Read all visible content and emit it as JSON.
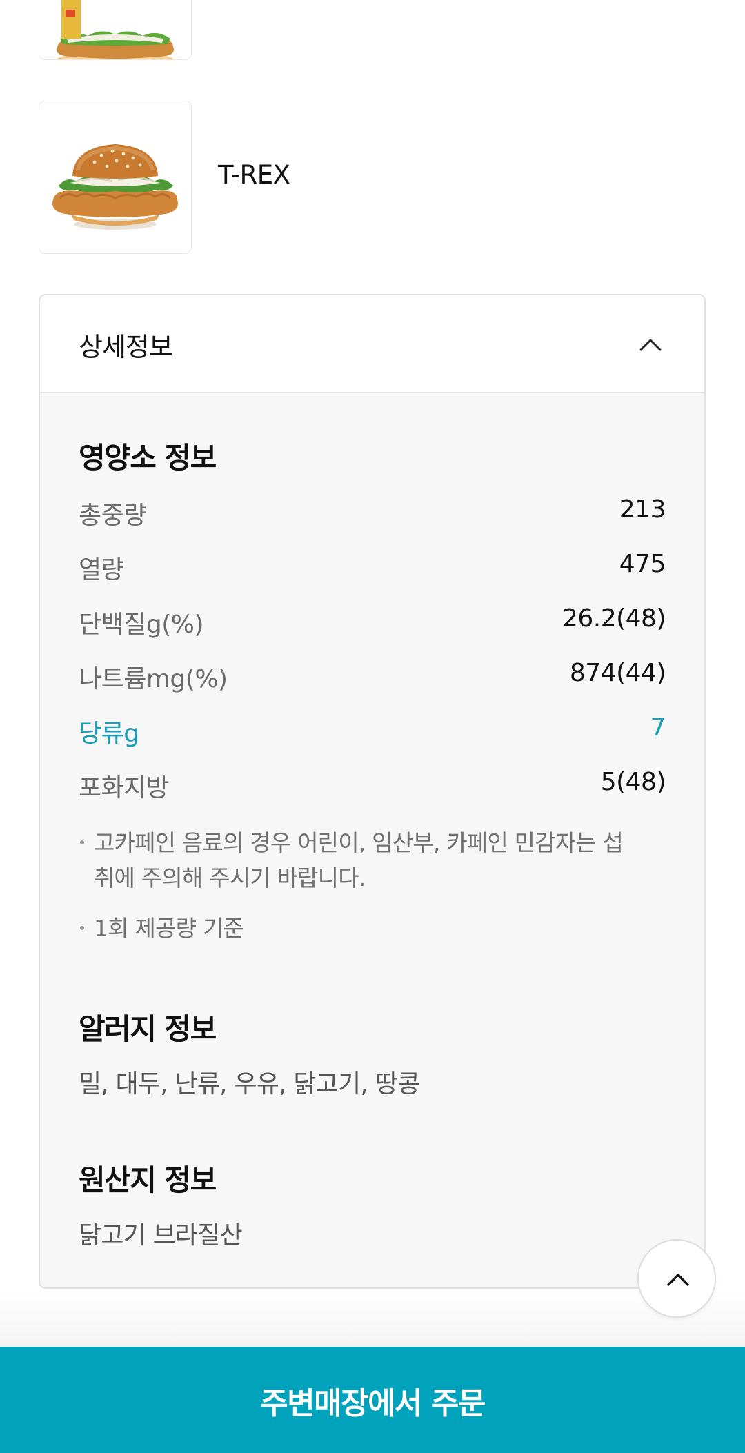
{
  "product": {
    "name": "T-REX"
  },
  "detail": {
    "title": "상세정보",
    "nutrition": {
      "title": "영양소 정보",
      "rows": [
        {
          "label": "총중량",
          "value": "213",
          "highlight": false
        },
        {
          "label": "열량",
          "value": "475",
          "highlight": false
        },
        {
          "label": "단백질g(%)",
          "value": "26.2(48)",
          "highlight": false
        },
        {
          "label": "나트륨mg(%)",
          "value": "874(44)",
          "highlight": false
        },
        {
          "label": "당류g",
          "value": "7",
          "highlight": true
        },
        {
          "label": "포화지방",
          "value": "5(48)",
          "highlight": false
        }
      ],
      "notes": [
        "고카페인 음료의 경우 어린이, 임산부, 카페인 민감자는 섭취에 주의해 주시기 바랍니다.",
        "1회 제공량 기준"
      ]
    },
    "allergy": {
      "title": "알러지 정보",
      "text": "밀, 대두, 난류, 우유, 닭고기, 땅콩"
    },
    "origin": {
      "title": "원산지 정보",
      "text": "닭고기 브라질산"
    }
  },
  "order_button": {
    "label": "주변매장에서 주문"
  },
  "colors": {
    "accent": "#00a3bb",
    "highlight_text": "#1a9eb8"
  },
  "icons": {
    "collapse": "chevron-up-icon",
    "scroll_top": "chevron-up-icon"
  }
}
